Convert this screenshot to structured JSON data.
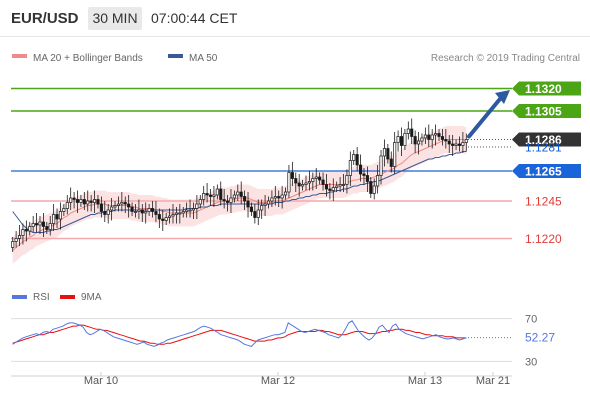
{
  "header": {
    "symbol": "EUR/USD",
    "timeframe": "30 MIN",
    "time": "07:00:44 CET"
  },
  "legend_main": [
    {
      "name": "MA 20 + Bollinger Bands",
      "color": "#f08a8a"
    },
    {
      "name": "MA 50",
      "color": "#3a5a95"
    }
  ],
  "copyright": "Research © 2019 Trading Central",
  "legend_osc": [
    {
      "name": "RSI",
      "color": "#5577dd"
    },
    {
      "name": "9MA",
      "color": "#e81010"
    }
  ],
  "chart_data": [
    {
      "type": "candlestick",
      "x_labels": [
        "Mar 10",
        "Mar 12",
        "Mar 13",
        "Mar 21"
      ],
      "ylim": [
        1.1205,
        1.1335
      ],
      "current_price": 1.1286,
      "levels": [
        {
          "value": 1.132,
          "label": "1.1320",
          "kind": "resistance",
          "color": "#4ca514"
        },
        {
          "value": 1.1305,
          "label": "1.1305",
          "kind": "resistance",
          "color": "#4ca514"
        },
        {
          "value": 1.1286,
          "label": "1.1286",
          "kind": "last",
          "color": "#333333"
        },
        {
          "value": 1.1281,
          "label": "1.1281",
          "kind": "pivot",
          "color": "#1160d8"
        },
        {
          "value": 1.1265,
          "label": "1.1265",
          "kind": "pivot",
          "color": "#1b63d8"
        },
        {
          "value": 1.1245,
          "label": "1.1245",
          "kind": "support",
          "color": "#e05050"
        },
        {
          "value": 1.122,
          "label": "1.1220",
          "kind": "support",
          "color": "#e05050"
        }
      ],
      "closes": [
        1.1218,
        1.122,
        1.1222,
        1.1226,
        1.1225,
        1.1228,
        1.123,
        1.1229,
        1.1231,
        1.1228,
        1.1226,
        1.123,
        1.1236,
        1.1233,
        1.1238,
        1.124,
        1.1244,
        1.1247,
        1.1246,
        1.1244,
        1.1246,
        1.1243,
        1.1245,
        1.1244,
        1.1246,
        1.1243,
        1.1238,
        1.1236,
        1.1239,
        1.1241,
        1.1242,
        1.1243,
        1.1244,
        1.1243,
        1.1241,
        1.1238,
        1.1238,
        1.1239,
        1.1237,
        1.1238,
        1.124,
        1.1238,
        1.1236,
        1.1233,
        1.1232,
        1.1234,
        1.1235,
        1.1236,
        1.1237,
        1.1237,
        1.1238,
        1.1239,
        1.1239,
        1.124,
        1.1243,
        1.1246,
        1.125,
        1.1249,
        1.1248,
        1.1249,
        1.1253,
        1.1246,
        1.1245,
        1.1244,
        1.1247,
        1.1249,
        1.1251,
        1.1248,
        1.1245,
        1.1241,
        1.1238,
        1.1234,
        1.1239,
        1.1242,
        1.1243,
        1.1245,
        1.1247,
        1.1248,
        1.1247,
        1.1249,
        1.1251,
        1.1264,
        1.126,
        1.1257,
        1.1255,
        1.1256,
        1.1257,
        1.1258,
        1.126,
        1.1261,
        1.1259,
        1.1256,
        1.1253,
        1.1252,
        1.1254,
        1.1255,
        1.1256,
        1.1256,
        1.1262,
        1.1272,
        1.1276,
        1.1269,
        1.1263,
        1.1262,
        1.1258,
        1.125,
        1.1255,
        1.1262,
        1.1275,
        1.128,
        1.1273,
        1.1268,
        1.1284,
        1.1288,
        1.1282,
        1.129,
        1.1293,
        1.1288,
        1.1283,
        1.1285,
        1.1287,
        1.1289,
        1.1286,
        1.1289,
        1.129,
        1.1288,
        1.1286,
        1.1285,
        1.1283,
        1.1282,
        1.1283,
        1.1282,
        1.1284,
        1.1286
      ],
      "ma20": [
        1.1212,
        1.1214,
        1.1216,
        1.1218,
        1.1219,
        1.1221,
        1.1222,
        1.1224,
        1.1225,
        1.1226,
        1.1227,
        1.1228,
        1.1229,
        1.123,
        1.1232,
        1.1234,
        1.1235,
        1.1237,
        1.1238,
        1.1239,
        1.124,
        1.1241,
        1.1242,
        1.1242,
        1.1243,
        1.1243,
        1.1243,
        1.1243,
        1.1242,
        1.1242,
        1.1242,
        1.1242,
        1.1242,
        1.1242,
        1.1242,
        1.1241,
        1.1241,
        1.124,
        1.124,
        1.124,
        1.124,
        1.124,
        1.1239,
        1.1239,
        1.1238,
        1.1238,
        1.1237,
        1.1237,
        1.1237,
        1.1237,
        1.1237,
        1.1237,
        1.1237,
        1.1237,
        1.1238,
        1.1239,
        1.124,
        1.1241,
        1.1242,
        1.1243,
        1.1244,
        1.1245,
        1.1245,
        1.1245,
        1.1246,
        1.1246,
        1.1247,
        1.1247,
        1.1247,
        1.1247,
        1.1246,
        1.1245,
        1.1244,
        1.1244,
        1.1244,
        1.1244,
        1.1244,
        1.1245,
        1.1245,
        1.1245,
        1.1246,
        1.1247,
        1.1248,
        1.1249,
        1.125,
        1.1251,
        1.1252,
        1.1253,
        1.1254,
        1.1255,
        1.1256,
        1.1256,
        1.1256,
        1.1256,
        1.1256,
        1.1256,
        1.1256,
        1.1256,
        1.1257,
        1.1258,
        1.1259,
        1.1259,
        1.126,
        1.126,
        1.126,
        1.126,
        1.1261,
        1.1262,
        1.1263,
        1.1264,
        1.1265,
        1.1266,
        1.1267,
        1.1269,
        1.127,
        1.1272,
        1.1274,
        1.1276,
        1.1277,
        1.1278,
        1.1279,
        1.128,
        1.1281,
        1.1282,
        1.1283,
        1.1284,
        1.1285,
        1.1286,
        1.1286,
        1.1286,
        1.1286,
        1.1286,
        1.1286,
        1.1285
      ],
      "ma50_x_from_index": 0,
      "ma50": [
        1.1238,
        1.1235,
        1.1232,
        1.1229,
        1.1227,
        1.1225,
        1.1224,
        1.1224,
        1.1224,
        1.1224,
        1.1225,
        1.1225,
        1.1226,
        1.1226,
        1.1227,
        1.1228,
        1.1229,
        1.123,
        1.1231,
        1.1232,
        1.1233,
        1.1234,
        1.1235,
        1.1236,
        1.1236,
        1.1237,
        1.1237,
        1.1238,
        1.1238,
        1.1238,
        1.1239,
        1.1239,
        1.1239,
        1.1239,
        1.1239,
        1.1239,
        1.1239,
        1.1239,
        1.1239,
        1.1239,
        1.1239,
        1.1239,
        1.1239,
        1.1239,
        1.1239,
        1.1239,
        1.1239,
        1.1239,
        1.1239,
        1.1239,
        1.1239,
        1.124,
        1.124,
        1.124,
        1.124,
        1.1241,
        1.1241,
        1.1241,
        1.1242,
        1.1242,
        1.1242,
        1.1243,
        1.1243,
        1.1243,
        1.1243,
        1.1243,
        1.1243,
        1.1243,
        1.1243,
        1.1243,
        1.1243,
        1.1243,
        1.1243,
        1.1243,
        1.1243,
        1.1243,
        1.1243,
        1.1244,
        1.1244,
        1.1244,
        1.1245,
        1.1245,
        1.1246,
        1.1246,
        1.1247,
        1.1247,
        1.1248,
        1.1248,
        1.1249,
        1.1249,
        1.125,
        1.125,
        1.125,
        1.1251,
        1.1251,
        1.1252,
        1.1252,
        1.1253,
        1.1253,
        1.1254,
        1.1255,
        1.1255,
        1.1256,
        1.1256,
        1.1257,
        1.1257,
        1.1258,
        1.1258,
        1.1259,
        1.126,
        1.1261,
        1.1262,
        1.1263,
        1.1264,
        1.1265,
        1.1266,
        1.1267,
        1.1268,
        1.1269,
        1.127,
        1.1271,
        1.1272,
        1.1273,
        1.1273,
        1.1274,
        1.1274,
        1.1275,
        1.1275,
        1.1276,
        1.1276,
        1.1277,
        1.1277,
        1.1278,
        1.1278
      ],
      "bb_half_width": 0.0009,
      "forecast_arrow": {
        "from": 1.1288,
        "to": 1.1319
      }
    },
    {
      "type": "line",
      "name": "RSI",
      "ylim": [
        20,
        80
      ],
      "ticks": [
        70,
        30
      ],
      "current_value": "52.27",
      "rsi": [
        46,
        48,
        50,
        52,
        53,
        54,
        55,
        56,
        55,
        57,
        58,
        57,
        60,
        61,
        62,
        63,
        65,
        66,
        66,
        65,
        64,
        62,
        57,
        55,
        56,
        58,
        60,
        59,
        57,
        55,
        53,
        52,
        51,
        50,
        49,
        48,
        47,
        46,
        47,
        48,
        46,
        45,
        44,
        45,
        47,
        48,
        50,
        51,
        52,
        53,
        54,
        55,
        56,
        57,
        58,
        60,
        62,
        63,
        62,
        61,
        59,
        57,
        55,
        54,
        53,
        52,
        51,
        50,
        48,
        46,
        45,
        44,
        47,
        50,
        51,
        52,
        53,
        54,
        55,
        55,
        56,
        57,
        66,
        64,
        62,
        60,
        58,
        57,
        58,
        59,
        60,
        59,
        58,
        57,
        55,
        54,
        53,
        52,
        55,
        60,
        66,
        68,
        63,
        58,
        55,
        52,
        50,
        52,
        56,
        62,
        64,
        60,
        57,
        63,
        65,
        60,
        58,
        56,
        55,
        54,
        53,
        52,
        51,
        52,
        53,
        54,
        55,
        53,
        52,
        51,
        51,
        52,
        51,
        50,
        51,
        52
      ],
      "ma9": [
        47,
        48,
        49,
        50,
        51,
        52,
        53,
        54,
        55,
        55,
        56,
        57,
        57,
        58,
        59,
        60,
        61,
        62,
        63,
        63,
        64,
        64,
        63,
        62,
        61,
        60,
        60,
        59,
        59,
        58,
        57,
        56,
        55,
        54,
        53,
        52,
        51,
        50,
        49,
        49,
        48,
        47,
        47,
        46,
        46,
        46,
        47,
        47,
        48,
        49,
        50,
        51,
        52,
        53,
        54,
        55,
        56,
        57,
        58,
        59,
        59,
        59,
        59,
        58,
        57,
        56,
        55,
        54,
        53,
        52,
        51,
        50,
        49,
        49,
        49,
        49,
        50,
        50,
        51,
        52,
        52,
        53,
        55,
        56,
        57,
        58,
        58,
        58,
        58,
        58,
        58,
        59,
        59,
        58,
        58,
        57,
        56,
        55,
        55,
        55,
        56,
        57,
        58,
        58,
        58,
        57,
        56,
        56,
        56,
        57,
        58,
        58,
        59,
        59,
        60,
        60,
        60,
        59,
        59,
        58,
        57,
        57,
        56,
        55,
        55,
        54,
        54,
        54,
        54,
        53,
        53,
        53,
        52,
        52,
        52,
        52
      ]
    }
  ]
}
